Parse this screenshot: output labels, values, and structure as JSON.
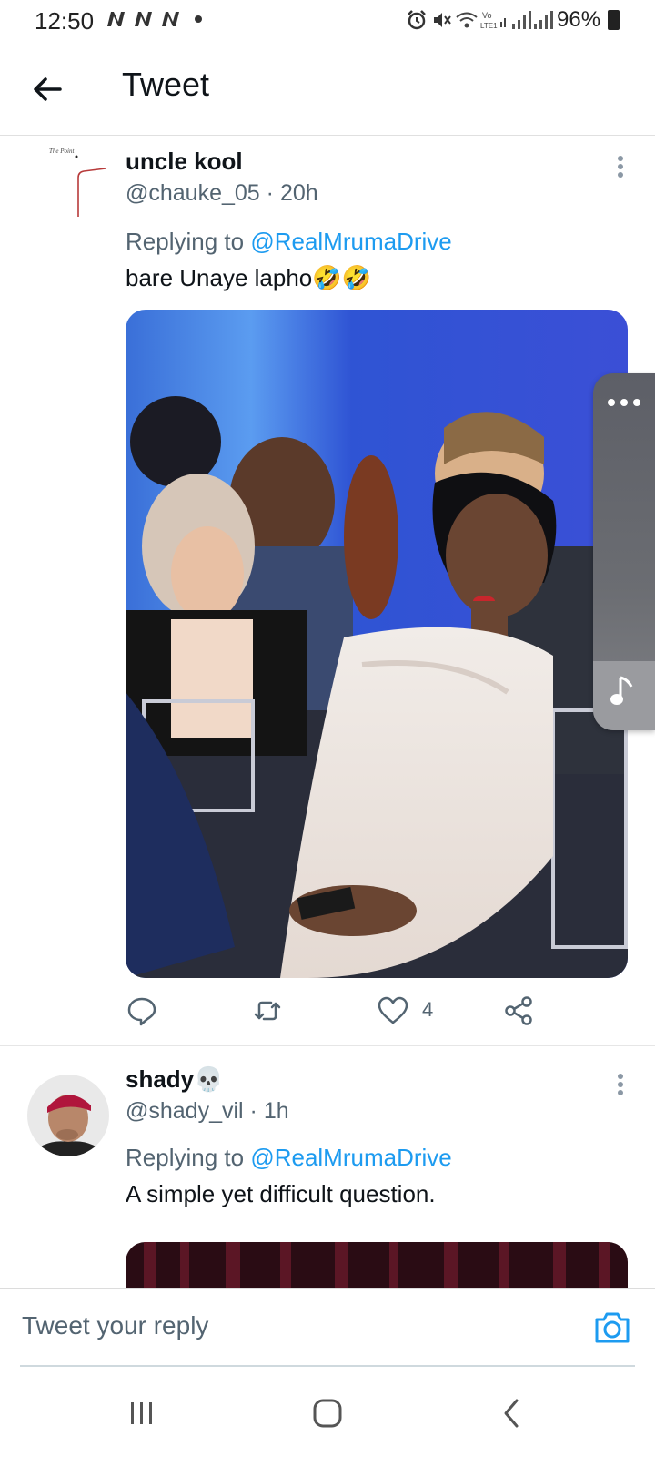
{
  "status_bar": {
    "time": "12:50",
    "battery": "96%"
  },
  "header": {
    "title": "Tweet"
  },
  "tweets": [
    {
      "name": "uncle kool",
      "handle": "@chauke_05",
      "time": "20h",
      "replying_label": "Replying to",
      "replying_to": "@RealMrumaDrive",
      "text": "bare Unaye lapho🤣🤣",
      "avatar_caption": "The Point",
      "like_count": "4"
    },
    {
      "name": "shady💀",
      "handle": "@shady_vil",
      "time": "1h",
      "replying_label": "Replying to",
      "replying_to": "@RealMrumaDrive",
      "text": "A simple yet difficult question."
    }
  ],
  "reply_bar": {
    "placeholder": "Tweet your reply"
  },
  "colors": {
    "accent": "#1d9bf0",
    "secondary_text": "#536471",
    "primary_text": "#0f1419"
  },
  "icons": {
    "back": "arrow-left",
    "more": "vertical-ellipsis",
    "reply": "speech-bubble",
    "retweet": "retweet-arrows",
    "like": "heart",
    "share": "share-nodes",
    "camera": "camera",
    "music": "music-note"
  }
}
